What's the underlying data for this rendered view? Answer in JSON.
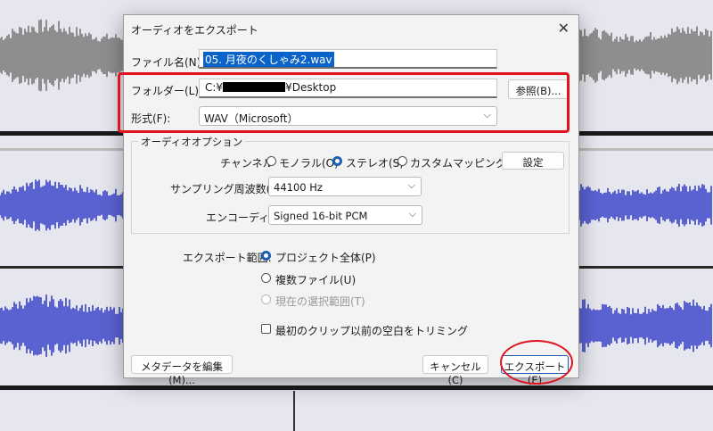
{
  "dialog": {
    "title": "オーディオをエクスポート",
    "close_glyph": "✕",
    "filename_label": "ファイル名(N):",
    "filename_value": "05. 月夜のくしゃみ2.wav",
    "folder_label": "フォルダー(L):",
    "folder_prefix": "C:¥",
    "folder_suffix": "¥Desktop",
    "browse_label": "参照(B)...",
    "format_label": "形式(F):",
    "format_value": "WAV（Microsoft）",
    "audio_options": {
      "group_title": "オーディオオプション",
      "channel_label": "チャンネル",
      "channel_options": [
        "モノラル(O)",
        "ステレオ(S)",
        "カスタムマッピング(G)"
      ],
      "channel_selected": "ステレオ(S)",
      "settings_button": "設定",
      "sample_rate_label": "サンプリング周波数(R)",
      "sample_rate_value": "44100 Hz",
      "encoding_label": "エンコーディング",
      "encoding_value": "Signed 16-bit PCM"
    },
    "export_range": {
      "label": "エクスポート範囲:",
      "options": [
        "プロジェクト全体(P)",
        "複数ファイル(U)",
        "現在の選択範囲(T)"
      ],
      "selected": "プロジェクト全体(P)",
      "disabled": "現在の選択範囲(T)"
    },
    "trim_label": "最初のクリップ以前の空白をトリミング",
    "trim_checked": false,
    "metadata_button": "メタデータを編集(M)...",
    "cancel_button": "キャンセル(C)",
    "export_button": "エクスポート(E)"
  },
  "colors": {
    "waveform_blue": "#5a62d2",
    "waveform_gray": "#8e8e8e",
    "annotation_red": "#e0141e",
    "accent": "#1c5fb0",
    "filename_highlight": "#0a63c9"
  }
}
